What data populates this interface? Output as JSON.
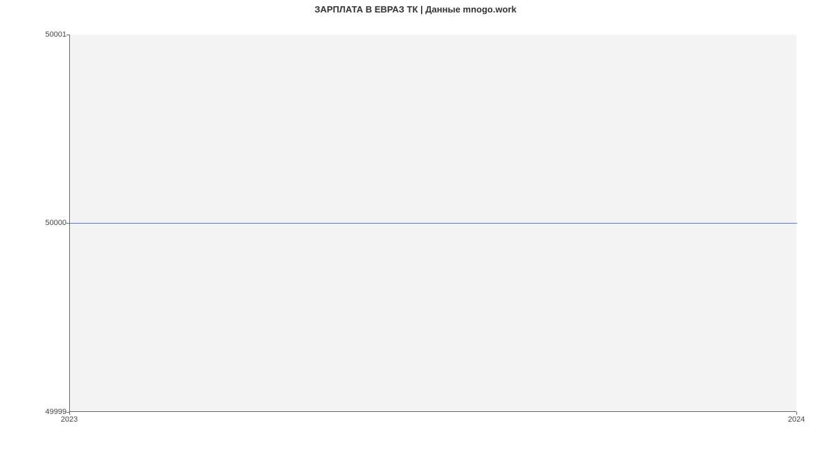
{
  "chart_data": {
    "type": "line",
    "title": "ЗАРПЛАТА В ЕВРАЗ ТК | Данные mnogo.work",
    "xlabel": "",
    "ylabel": "",
    "x": [
      "2023",
      "2024"
    ],
    "y": [
      50000,
      50000
    ],
    "x_ticks": [
      "2023",
      "2024"
    ],
    "y_ticks": [
      49999,
      50000,
      50001
    ],
    "ylim": [
      49999,
      50001
    ],
    "line_color": "#4a7fe0",
    "grid": false
  }
}
